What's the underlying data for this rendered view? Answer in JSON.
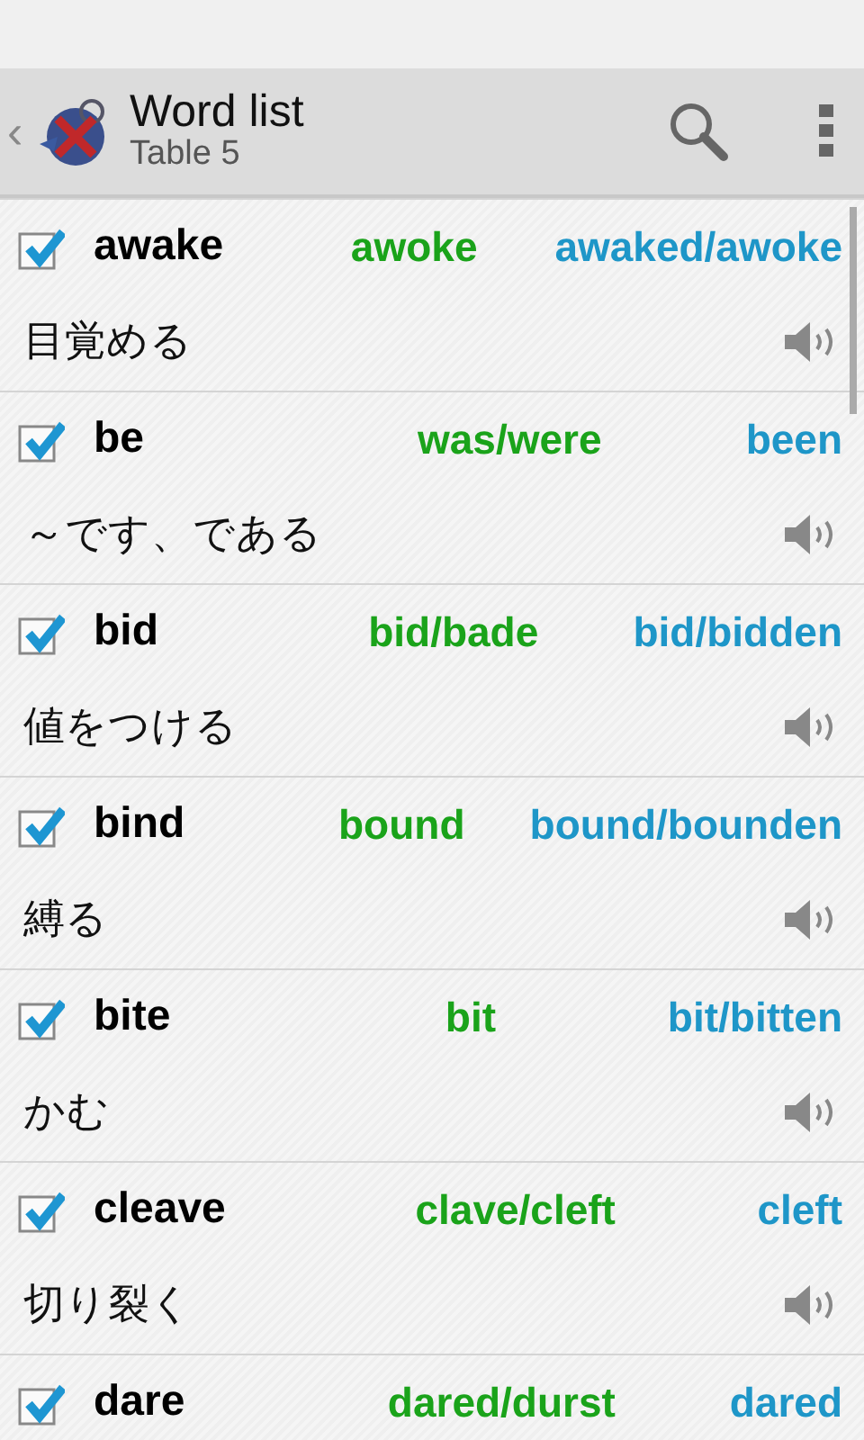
{
  "app_bar": {
    "title": "Word list",
    "subtitle": "Table 5",
    "back": "‹"
  },
  "words": [
    {
      "checked": true,
      "base": "awake",
      "past": "awoke",
      "participle": "awaked/awoke",
      "meaning": "目覚める"
    },
    {
      "checked": true,
      "base": "be",
      "past": "was/were",
      "participle": "been",
      "meaning": "～です、である"
    },
    {
      "checked": true,
      "base": "bid",
      "past": "bid/bade",
      "participle": "bid/bidden",
      "meaning": "値をつける"
    },
    {
      "checked": true,
      "base": "bind",
      "past": "bound",
      "participle": "bound/bounden",
      "meaning": "縛る"
    },
    {
      "checked": true,
      "base": "bite",
      "past": "bit",
      "participle": "bit/bitten",
      "meaning": "かむ"
    },
    {
      "checked": true,
      "base": "cleave",
      "past": "clave/cleft",
      "participle": "cleft",
      "meaning": "切り裂く"
    },
    {
      "checked": true,
      "base": "dare",
      "past": "dared/durst",
      "participle": "dared"
    }
  ]
}
